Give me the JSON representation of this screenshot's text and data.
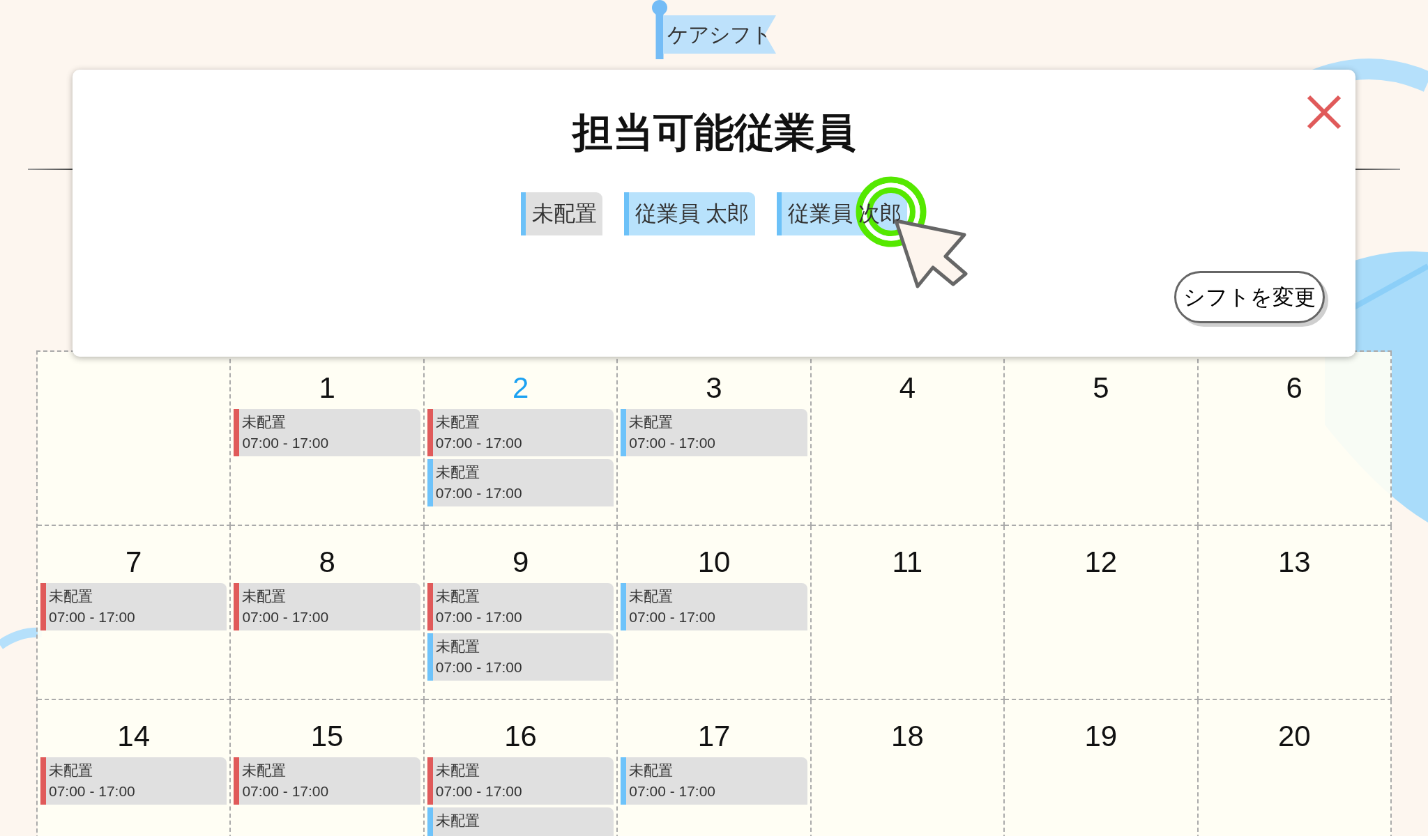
{
  "header": {
    "logo": "ケアシフト"
  },
  "modal": {
    "title": "担当可能従業員",
    "employees": [
      {
        "name": "未配置",
        "kind": "unassigned"
      },
      {
        "name": "従業員 太郎",
        "kind": "employee"
      },
      {
        "name": "従業員 次郎",
        "kind": "employee"
      }
    ],
    "submit_button": "シフトを変更"
  },
  "calendar": {
    "weeks": [
      {
        "days": [
          {
            "kind": "empty"
          },
          {
            "kind": "day",
            "day": "1",
            "today": false,
            "shifts": [
              {
                "label": "未配置",
                "time": "07:00 - 17:00",
                "color": "#e05a5a"
              }
            ]
          },
          {
            "kind": "day",
            "day": "2",
            "today": true,
            "shifts": [
              {
                "label": "未配置",
                "time": "07:00 - 17:00",
                "color": "#e05a5a"
              },
              {
                "label": "未配置",
                "time": "07:00 - 17:00",
                "color": "#6ec3fa"
              }
            ]
          },
          {
            "kind": "day",
            "day": "3",
            "today": false,
            "shifts": [
              {
                "label": "未配置",
                "time": "07:00 - 17:00",
                "color": "#6ec3fa"
              }
            ]
          },
          {
            "kind": "day",
            "day": "4",
            "today": false
          },
          {
            "kind": "day",
            "day": "5",
            "today": false
          },
          {
            "kind": "day",
            "day": "6",
            "today": false
          }
        ]
      },
      {
        "days": [
          {
            "kind": "day",
            "day": "7",
            "today": false,
            "shifts": [
              {
                "label": "未配置",
                "time": "07:00 - 17:00",
                "color": "#e05a5a"
              }
            ]
          },
          {
            "kind": "day",
            "day": "8",
            "today": false,
            "shifts": [
              {
                "label": "未配置",
                "time": "07:00 - 17:00",
                "color": "#e05a5a"
              }
            ]
          },
          {
            "kind": "day",
            "day": "9",
            "today": false,
            "shifts": [
              {
                "label": "未配置",
                "time": "07:00 - 17:00",
                "color": "#e05a5a"
              },
              {
                "label": "未配置",
                "time": "07:00 - 17:00",
                "color": "#6ec3fa"
              }
            ]
          },
          {
            "kind": "day",
            "day": "10",
            "today": false,
            "shifts": [
              {
                "label": "未配置",
                "time": "07:00 - 17:00",
                "color": "#6ec3fa"
              }
            ]
          },
          {
            "kind": "day",
            "day": "11",
            "today": false
          },
          {
            "kind": "day",
            "day": "12",
            "today": false
          },
          {
            "kind": "day",
            "day": "13",
            "today": false
          }
        ]
      },
      {
        "days": [
          {
            "kind": "day",
            "day": "14",
            "today": false,
            "shifts": [
              {
                "label": "未配置",
                "time": "07:00 - 17:00",
                "color": "#e05a5a"
              }
            ]
          },
          {
            "kind": "day",
            "day": "15",
            "today": false,
            "shifts": [
              {
                "label": "未配置",
                "time": "07:00 - 17:00",
                "color": "#e05a5a"
              }
            ]
          },
          {
            "kind": "day",
            "day": "16",
            "today": false,
            "shifts": [
              {
                "label": "未配置",
                "time": "07:00 - 17:00",
                "color": "#e05a5a"
              },
              {
                "label": "未配置",
                "color": "#6ec3fa"
              }
            ]
          },
          {
            "kind": "day",
            "day": "17",
            "today": false,
            "shifts": [
              {
                "label": "未配置",
                "time": "07:00 - 17:00",
                "color": "#6ec3fa"
              }
            ]
          },
          {
            "kind": "day",
            "day": "18",
            "today": false
          },
          {
            "kind": "day",
            "day": "19",
            "today": false
          },
          {
            "kind": "day",
            "day": "20",
            "today": false
          }
        ]
      }
    ]
  }
}
